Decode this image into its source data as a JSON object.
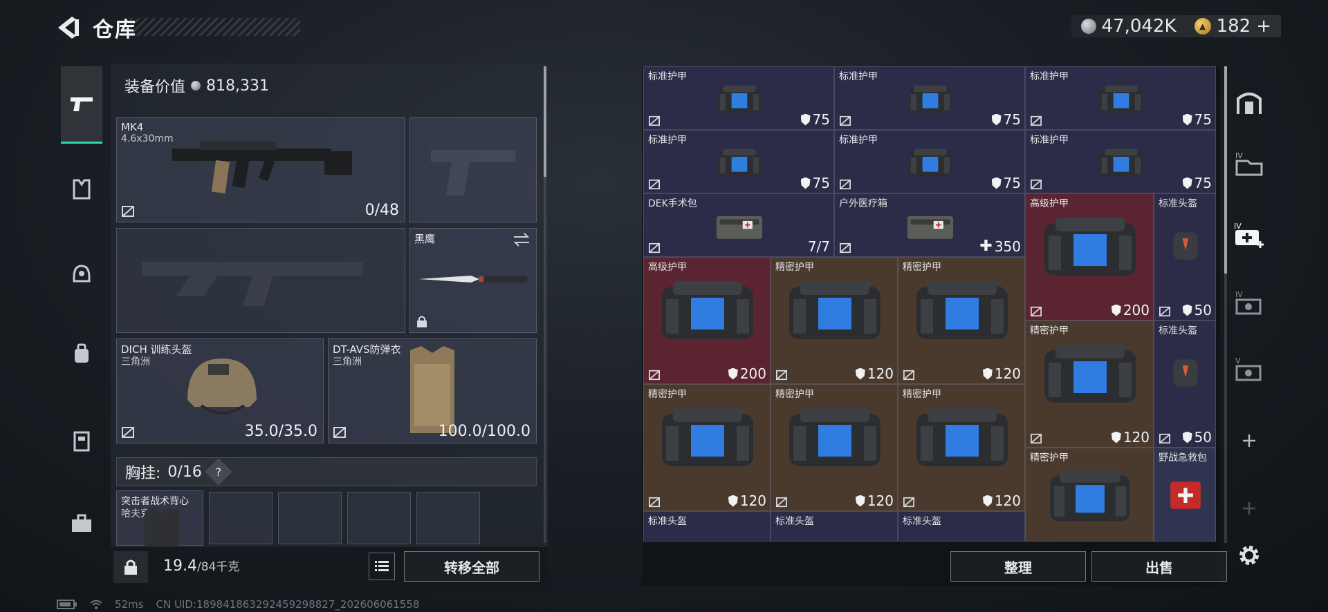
{
  "header": {
    "title": "仓库",
    "currency_main": "47,042K",
    "currency_secondary": "182",
    "currency_add": "+"
  },
  "equipment": {
    "value_label": "装备价值",
    "value": "818,331",
    "primary_weapon": {
      "name": "MK4",
      "caliber": "4.6x30mm",
      "ammo": "0/48"
    },
    "melee": {
      "name": "黑鹰"
    },
    "helmet": {
      "name": "DICH 训练头盔",
      "sub": "三角洲",
      "durability": "35.0/35.0"
    },
    "armor": {
      "name": "DT-AVS防弹衣",
      "sub": "三角洲",
      "durability": "100.0/100.0"
    },
    "chest_rig": {
      "label": "胸挂:",
      "capacity": "0/16",
      "help": "?"
    },
    "backpack": {
      "name": "突击者战术背心",
      "sub": "哈夫克"
    }
  },
  "bottom_bar": {
    "weight_value": "19.4",
    "weight_max": "/84千克",
    "transfer_all": "转移全部"
  },
  "storage": {
    "sort_label": "整理",
    "sell_label": "出售",
    "items": [
      {
        "name": "标准护甲",
        "value": "75",
        "kind": "shield",
        "color": "std"
      },
      {
        "name": "标准护甲",
        "value": "75",
        "kind": "shield",
        "color": "std"
      },
      {
        "name": "标准护甲",
        "value": "75",
        "kind": "shield",
        "color": "std"
      },
      {
        "name": "标准护甲",
        "value": "75",
        "kind": "shield",
        "color": "std"
      },
      {
        "name": "标准护甲",
        "value": "75",
        "kind": "shield",
        "color": "std"
      },
      {
        "name": "标准护甲",
        "value": "75",
        "kind": "shield",
        "color": "std"
      },
      {
        "name": "DEK手术包",
        "value": "7/7",
        "kind": "count",
        "color": "std"
      },
      {
        "name": "户外医疗箱",
        "value": "350",
        "kind": "plus",
        "color": "std"
      },
      {
        "name": "高级护甲",
        "value": "200",
        "kind": "shield",
        "color": "red"
      },
      {
        "name": "标准头盔",
        "value": "50",
        "kind": "shield",
        "color": "std"
      },
      {
        "name": "高级护甲",
        "value": "200",
        "kind": "shield",
        "color": "red"
      },
      {
        "name": "精密护甲",
        "value": "120",
        "kind": "shield",
        "color": "brown"
      },
      {
        "name": "精密护甲",
        "value": "120",
        "kind": "shield",
        "color": "brown"
      },
      {
        "name": "精密护甲",
        "value": "120",
        "kind": "shield",
        "color": "brown"
      },
      {
        "name": "标准头盔",
        "value": "50",
        "kind": "shield",
        "color": "std"
      },
      {
        "name": "精密护甲",
        "value": "120",
        "kind": "shield",
        "color": "brown"
      },
      {
        "name": "精密护甲",
        "value": "120",
        "kind": "shield",
        "color": "brown"
      },
      {
        "name": "精密护甲",
        "value": "120",
        "kind": "shield",
        "color": "brown"
      },
      {
        "name": "精密护甲",
        "value": "",
        "kind": "shield",
        "color": "brown"
      },
      {
        "name": "野战急救包",
        "value": "",
        "kind": "none",
        "color": "blue"
      },
      {
        "name": "标准头盔",
        "value": "",
        "kind": "none",
        "color": "std"
      },
      {
        "name": "标准头盔",
        "value": "",
        "kind": "none",
        "color": "std"
      },
      {
        "name": "标准头盔",
        "value": "",
        "kind": "none",
        "color": "std"
      }
    ]
  },
  "status_bar": {
    "ping": "52ms",
    "uid": "CN UID:18984186329245929882​7_202606061558"
  },
  "colors": {
    "accent": "#2ddbb0",
    "cell_std": "#2d2c48",
    "cell_red": "#5a2430",
    "cell_brown": "#4a3a2e",
    "cell_blue": "#2f3550"
  }
}
